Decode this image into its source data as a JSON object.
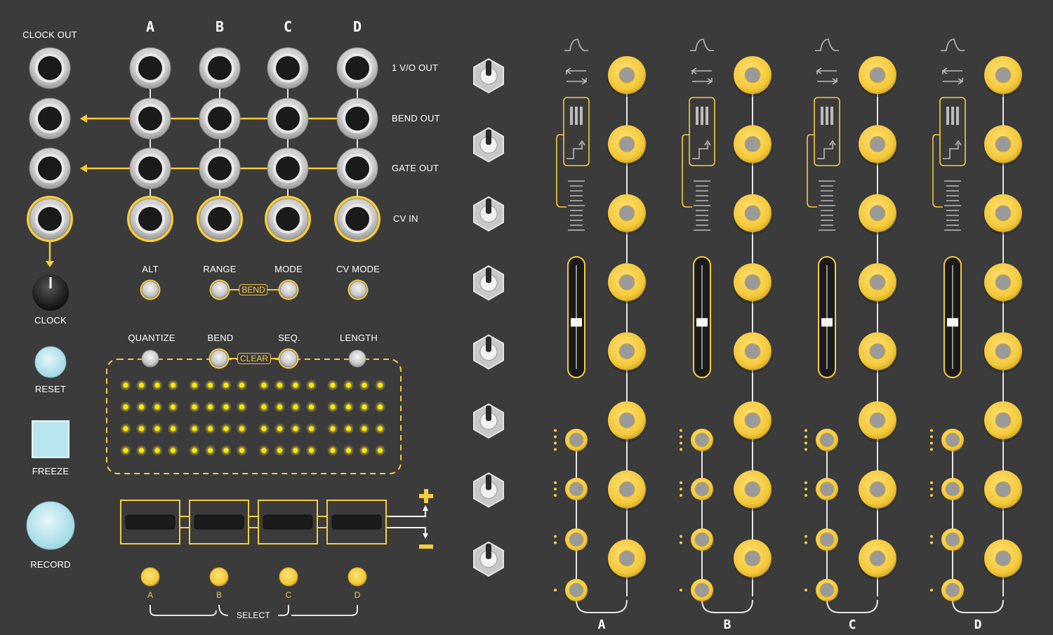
{
  "colors": {
    "panel": "#3b3b3b",
    "accent": "#f5cc3d",
    "jack_silver": "#cfcfcf",
    "led": "#ffe600",
    "button_blue": "#b8e6ee"
  },
  "left": {
    "clock_out_label": "CLOCK OUT",
    "clock_label": "CLOCK",
    "reset_label": "RESET",
    "freeze_label": "FREEZE",
    "record_label": "RECORD"
  },
  "matrix": {
    "columns": [
      "A",
      "B",
      "C",
      "D"
    ],
    "rows": [
      {
        "label": "1 V/O OUT"
      },
      {
        "label": "BEND OUT"
      },
      {
        "label": "GATE OUT"
      },
      {
        "label": "CV IN"
      }
    ]
  },
  "buttons_row1": {
    "alt": "ALT",
    "range": "RANGE",
    "mode": "MODE",
    "cv_mode": "CV MODE",
    "bend_tag": "BEND"
  },
  "buttons_row2": {
    "quantize": "QUANTIZE",
    "bend": "BEND",
    "seq": "SEQ.",
    "length": "LENGTH",
    "clear_tag": "CLEAR"
  },
  "led_grid": {
    "rows": 4,
    "groups": 4,
    "per_group": 4,
    "all_lit": true
  },
  "pads": {
    "count": 4,
    "plus_icon": "plus-icon",
    "minus_icon": "minus-icon"
  },
  "select": {
    "buttons": [
      "A",
      "B",
      "C",
      "D"
    ],
    "label": "SELECT"
  },
  "toggles": {
    "count": 8
  },
  "channels": {
    "labels": [
      "A",
      "B",
      "C",
      "D"
    ],
    "icons": [
      "envelope-icon",
      "loop-icon",
      "quantize-bars-icon",
      "slew-icon",
      "scale-icon"
    ],
    "slider_position": 0.55
  }
}
